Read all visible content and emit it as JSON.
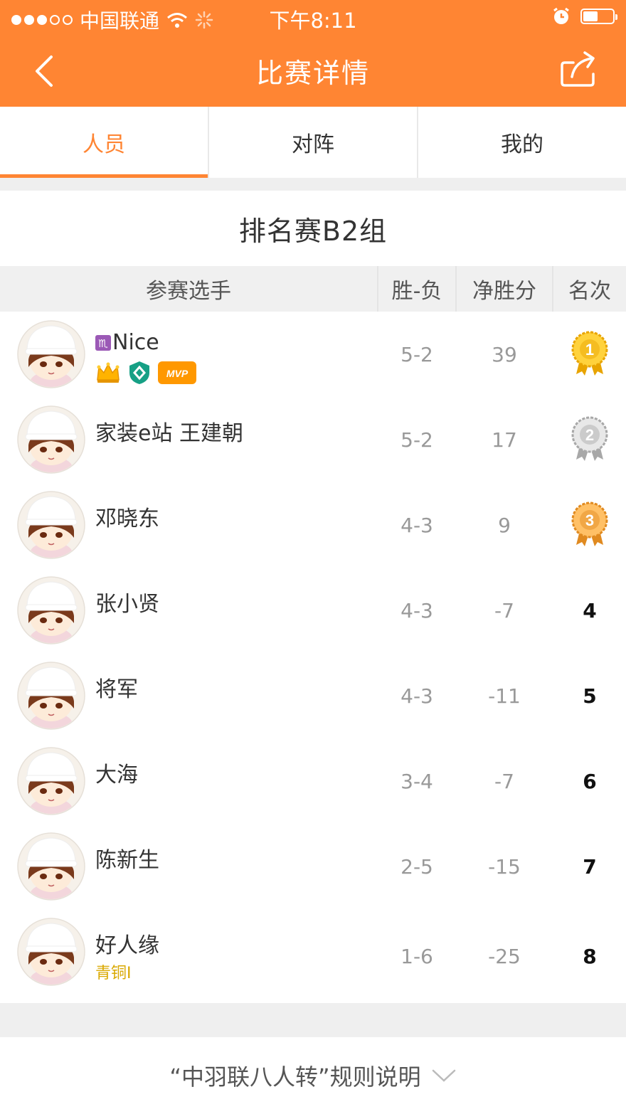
{
  "status_bar": {
    "carrier": "中国联通",
    "time": "下午8:11"
  },
  "nav": {
    "title": "比赛详情"
  },
  "tabs": [
    {
      "label": "人员",
      "active": true
    },
    {
      "label": "对阵",
      "active": false
    },
    {
      "label": "我的",
      "active": false
    }
  ],
  "group": {
    "title": "排名赛B2组"
  },
  "table": {
    "headers": {
      "player": "参赛选手",
      "record": "胜-负",
      "net": "净胜分",
      "rank": "名次"
    },
    "rows": [
      {
        "name": "Nice",
        "record": "5-2",
        "net": "39",
        "rank": "1",
        "medal": "gold",
        "badge_text": "MVP"
      },
      {
        "name": "家装e站 王建朝",
        "record": "5-2",
        "net": "17",
        "rank": "2",
        "medal": "silver"
      },
      {
        "name": "邓晓东",
        "record": "4-3",
        "net": "9",
        "rank": "3",
        "medal": "bronze"
      },
      {
        "name": "张小贤",
        "record": "4-3",
        "net": "-7",
        "rank": "4"
      },
      {
        "name": "将军",
        "record": "4-3",
        "net": "-11",
        "rank": "5"
      },
      {
        "name": "大海",
        "record": "3-4",
        "net": "-7",
        "rank": "6"
      },
      {
        "name": "陈新生",
        "record": "2-5",
        "net": "-15",
        "rank": "7"
      },
      {
        "name": "好人缘",
        "record": "1-6",
        "net": "-25",
        "rank": "8",
        "level": "青铜I"
      }
    ]
  },
  "footer": {
    "rules_label": "“中羽联八人转”规则说明"
  },
  "colors": {
    "brand": "#ff8533",
    "gold": "#f5b800",
    "silver": "#c8c8c8",
    "bronze": "#f0a030",
    "level": "#d9a800"
  }
}
